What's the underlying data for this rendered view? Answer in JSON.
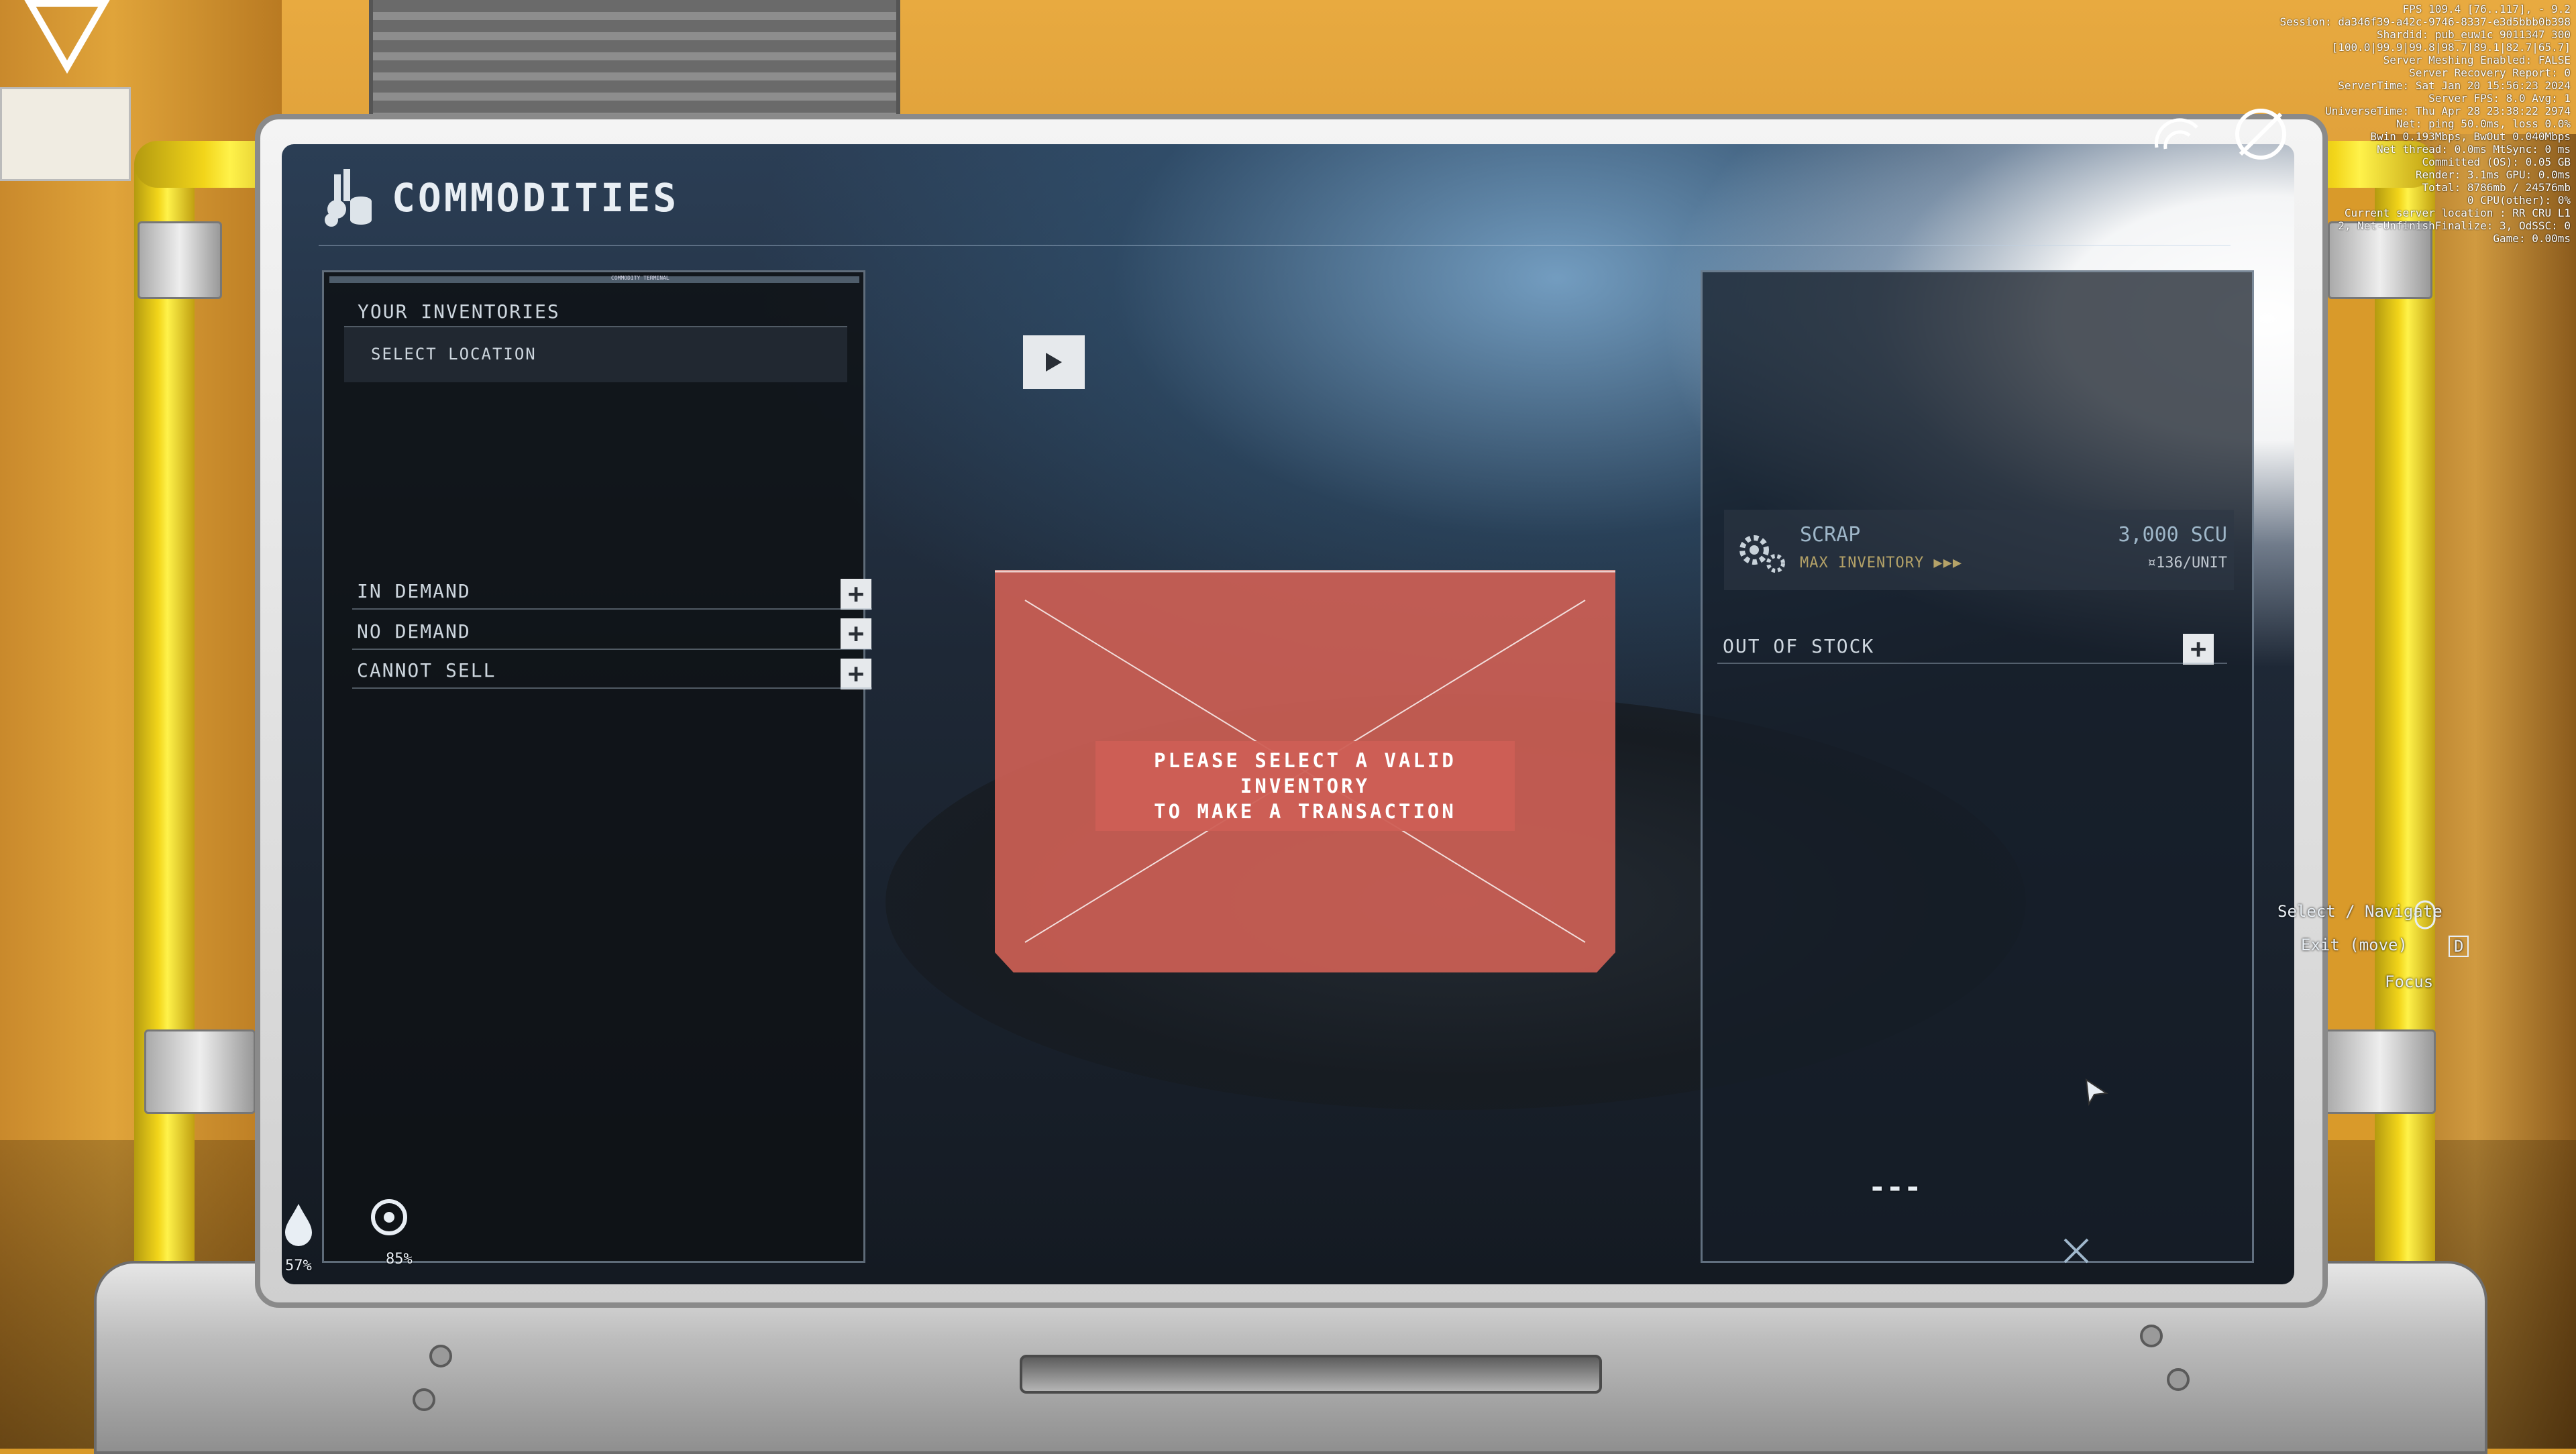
{
  "debug_overlay": [
    "FPS 109.4 [76..117], - 9.2",
    "Session: da346f39-a42c-9746-8337-e3d5bbb0b398",
    "Shardid: pub_euw1c 9011347 300",
    "[100.0|99.9|99.8|98.7|89.1|82.7|65.7]",
    "Server Meshing Enabled: FALSE",
    "Server Recovery Report: 0",
    "ServerTime: Sat Jan 20 15:56:23 2024",
    "Server FPS: 8.0 Avg: 1",
    "UniverseTime: Thu Apr 28 23:38:22 2974",
    "Net: ping 50.0ms, loss 0.0%",
    "Bwin 0.193Mbps, BwOut 0.040Mbps",
    "Net thread: 0.0ms MtSync: 0 ms",
    "Committed (OS): 0.05 GB",
    "Render: 3.1ms GPU: 0.0ms",
    "Total: 8786mb / 24576mb",
    "0 CPU(other): 0%",
    "Current server location : RR CRU L1",
    "2, Net-UnfinishFinalize: 3, OdSSC: 0",
    "Game: 0.00ms"
  ],
  "app": {
    "title": "COMMODITIES",
    "panel_caption": "COMMODITY TERMINAL"
  },
  "inventory": {
    "heading": "YOUR INVENTORIES",
    "select_location": "SELECT LOCATION"
  },
  "sell_sections": [
    {
      "label": "IN DEMAND"
    },
    {
      "label": "NO DEMAND"
    },
    {
      "label": "CANNOT SELL"
    }
  ],
  "message": {
    "line1": "PLEASE SELECT A VALID INVENTORY",
    "line2": "TO MAKE A TRANSACTION"
  },
  "commodity_item": {
    "name": "SCRAP",
    "max_inventory": "MAX INVENTORY ▶▶▶",
    "scu": "3,000 SCU",
    "price": "¤136/UNIT"
  },
  "out_of_stock": {
    "label": "OUT OF STOCK"
  },
  "status": {
    "left_percent": "57%",
    "right_percent": "85%",
    "dashes": "---"
  },
  "hints": {
    "select": "Select / Navigate",
    "exit": "Exit (move)",
    "key_d": "D",
    "focus": "Focus"
  },
  "colors": {
    "error_red": "#cd5f55",
    "frame_yellow": "#f2d51a",
    "wall_orange": "#d99a2a"
  }
}
